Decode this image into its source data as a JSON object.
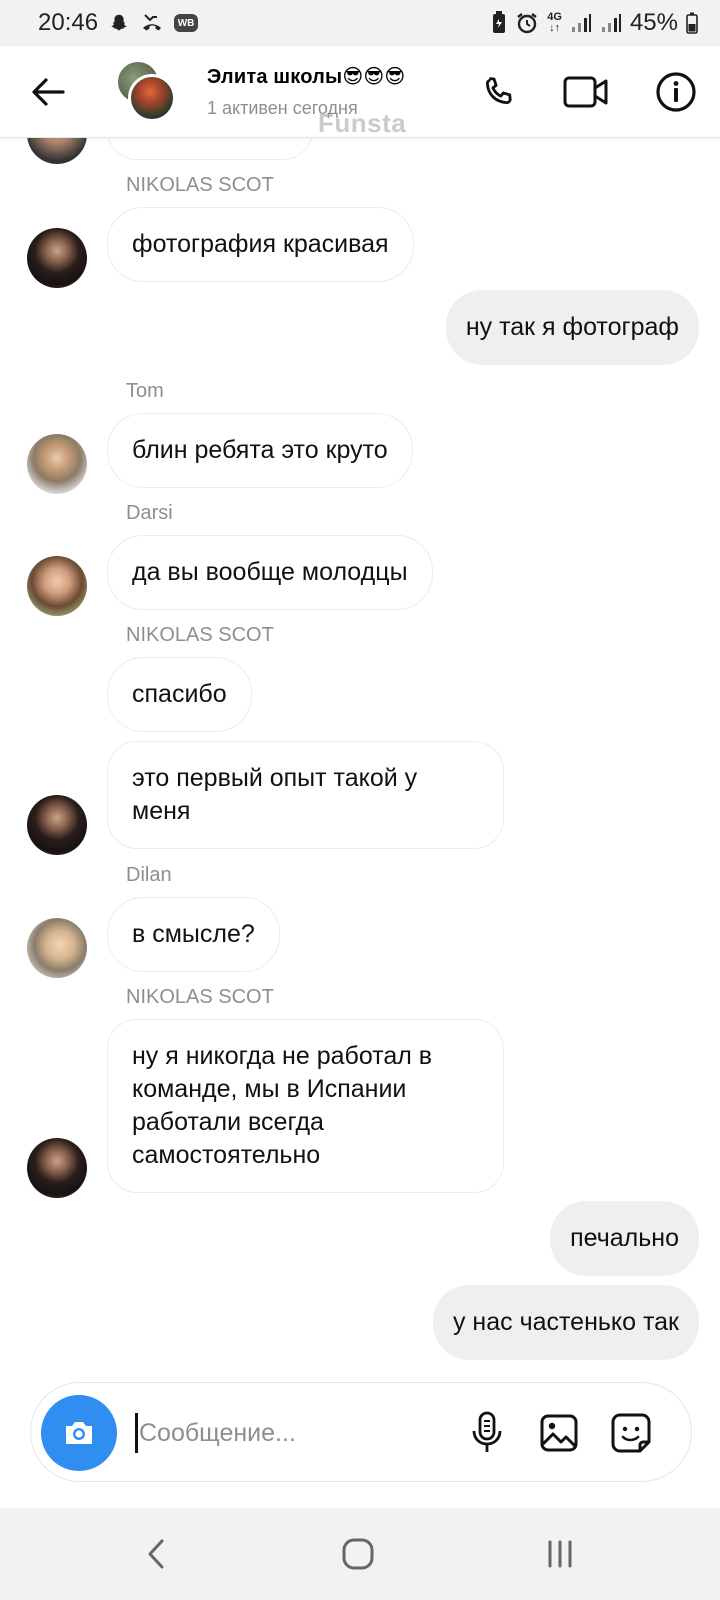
{
  "status_bar": {
    "time": "20:46",
    "wb_badge": "WB",
    "network": "4G",
    "battery": "45%",
    "icons": [
      "snapchat-icon",
      "missed-call-icon",
      "wb-app-icon",
      "battery-saver-icon",
      "alarm-icon",
      "network-4g-icon",
      "signal-icon",
      "signal-icon",
      "battery-icon"
    ]
  },
  "header": {
    "title": "Элита школы😎😎😎",
    "subtitle": "1 активен сегодня",
    "watermark": "Funsta",
    "icons": [
      "back-arrow-icon",
      "phone-icon",
      "video-camera-icon",
      "info-icon"
    ]
  },
  "messages": [
    {
      "sender": "NIKOLAS SCOT",
      "text": "фотография красивая",
      "direction": "in"
    },
    {
      "text": "ну так я фотограф",
      "direction": "out"
    },
    {
      "sender": "Tom",
      "text": "блин ребята это круто",
      "direction": "in"
    },
    {
      "sender": "Darsi",
      "text": "да вы вообще молодцы",
      "direction": "in"
    },
    {
      "sender": "NIKOLAS SCOT",
      "text": "спасибо",
      "direction": "in"
    },
    {
      "text": "это первый опыт такой у меня",
      "direction": "in"
    },
    {
      "sender": "Dilan",
      "text": "в смысле?",
      "direction": "in"
    },
    {
      "sender": "NIKOLAS SCOT",
      "text": "ну я никогда не работал в команде, мы в Испании работали всегда самостоятельно",
      "direction": "in"
    },
    {
      "text": "печально",
      "direction": "out"
    },
    {
      "text": "у нас частенько так",
      "direction": "out"
    }
  ],
  "composer": {
    "placeholder": "Сообщение...",
    "value": "",
    "icons": [
      "camera-icon",
      "microphone-icon",
      "gallery-icon",
      "sticker-icon"
    ]
  },
  "nav_bar": {
    "icons": [
      "nav-back-icon",
      "nav-home-icon",
      "nav-recents-icon"
    ]
  },
  "colors": {
    "accent": "#2f8ef0",
    "incoming_bubble_border": "#ececec",
    "outgoing_bubble": "#efefef",
    "secondary_text": "#8e8e8e"
  }
}
